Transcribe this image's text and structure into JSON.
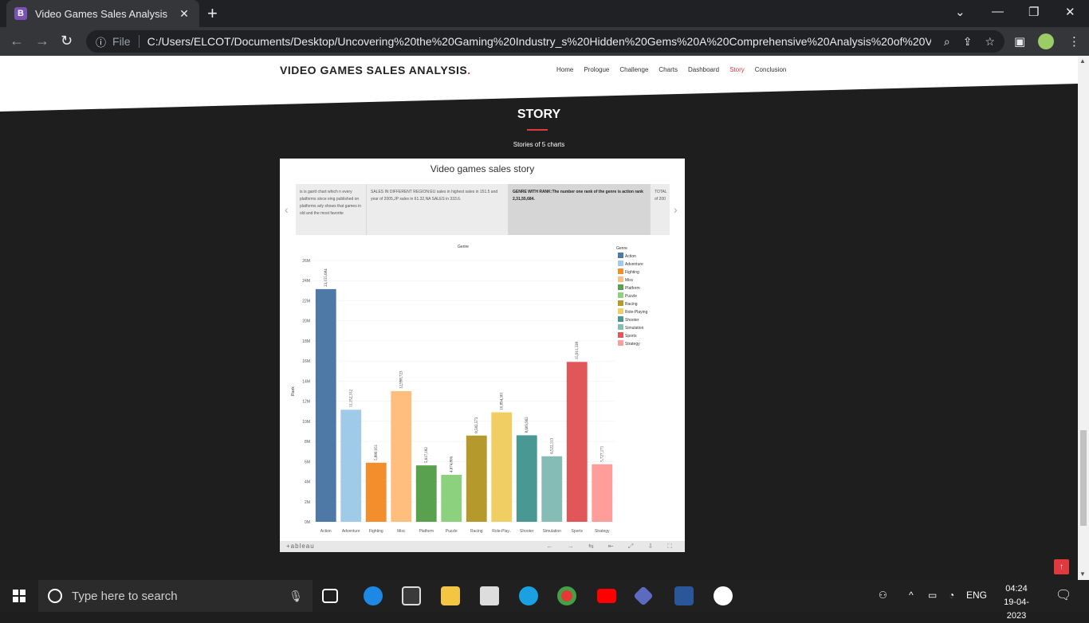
{
  "browser": {
    "tab_title": "Video Games Sales Analysis",
    "tab_favicon": "B",
    "file_label": "File",
    "url": "C:/Users/ELCOT/Documents/Desktop/Uncovering%20the%20Gaming%20Industry_s%20Hidden%20Gems%20A%20Comprehensive%20Analysis%20of%20Vid..."
  },
  "site": {
    "title": "VIDEO GAMES SALES ANALYSIS",
    "title_dot": ".",
    "nav": [
      "Home",
      "Prologue",
      "Challenge",
      "Charts",
      "Dashboard",
      "Story",
      "Conclusion"
    ],
    "active_nav": "Story",
    "section_title": "STORY",
    "section_subtitle": "Stories of 5 charts"
  },
  "tableau": {
    "title": "Video games sales story",
    "story_points": [
      "is is gantt chart which n every platforms since eing published on platforms arly shows that games in old and the most favorite",
      "SALES IN DIFFERENT REGION:EU sales in highest sales in 151.5 and year of 2005,JP sales in 61.32,NA SALES in 333.6.",
      "GENRE WITH RANK:The number one rank of the genre is action rank 2,31,55,684.",
      "TOTAL of 200"
    ],
    "footer_logo": "+ableau"
  },
  "chart_data": {
    "type": "bar",
    "title": "Genre",
    "xlabel": "",
    "ylabel": "Rank",
    "ylim": [
      0,
      26000000
    ],
    "yticks": [
      "0M",
      "2M",
      "4M",
      "6M",
      "8M",
      "10M",
      "12M",
      "14M",
      "16M",
      "18M",
      "20M",
      "22M",
      "24M",
      "26M"
    ],
    "categories": [
      "Action",
      "Adventure",
      "Fighting",
      "Misc",
      "Platform",
      "Puzzle",
      "Racing",
      "Role-Play..",
      "Shooter",
      "Simulation",
      "Sports",
      "Strategy"
    ],
    "values": [
      23155684,
      11152312,
      5880051,
      12998723,
      5617182,
      4674806,
      8582573,
      10894301,
      8609962,
      6522113,
      15911338,
      5727171
    ],
    "value_labels": [
      "23,155,684",
      "11,152,312",
      "5,880,051",
      "12,998,723",
      "5,617,182",
      "4,674,806",
      "8,582,573",
      "10,894,301",
      "8,609,962",
      "6,522,113",
      "15,911,338",
      "5,727,171"
    ],
    "colors": [
      "#4e79a7",
      "#a0cbe8",
      "#f28e2b",
      "#ffbe7d",
      "#59a14f",
      "#8cd17d",
      "#b6992d",
      "#f1ce63",
      "#499894",
      "#86bcb6",
      "#e15759",
      "#ff9d9a"
    ],
    "legend_title": "Genre",
    "legend": [
      "Action",
      "Adventure",
      "Fighting",
      "Misc",
      "Platform",
      "Puzzle",
      "Racing",
      "Role-Playing",
      "Shooter",
      "Simulation",
      "Sports",
      "Strategy"
    ],
    "legend_position": "top-right",
    "grid": true
  },
  "taskbar": {
    "search_placeholder": "Type here to search",
    "language": "ENG",
    "time": "04:24",
    "date": "19-04-2023"
  }
}
